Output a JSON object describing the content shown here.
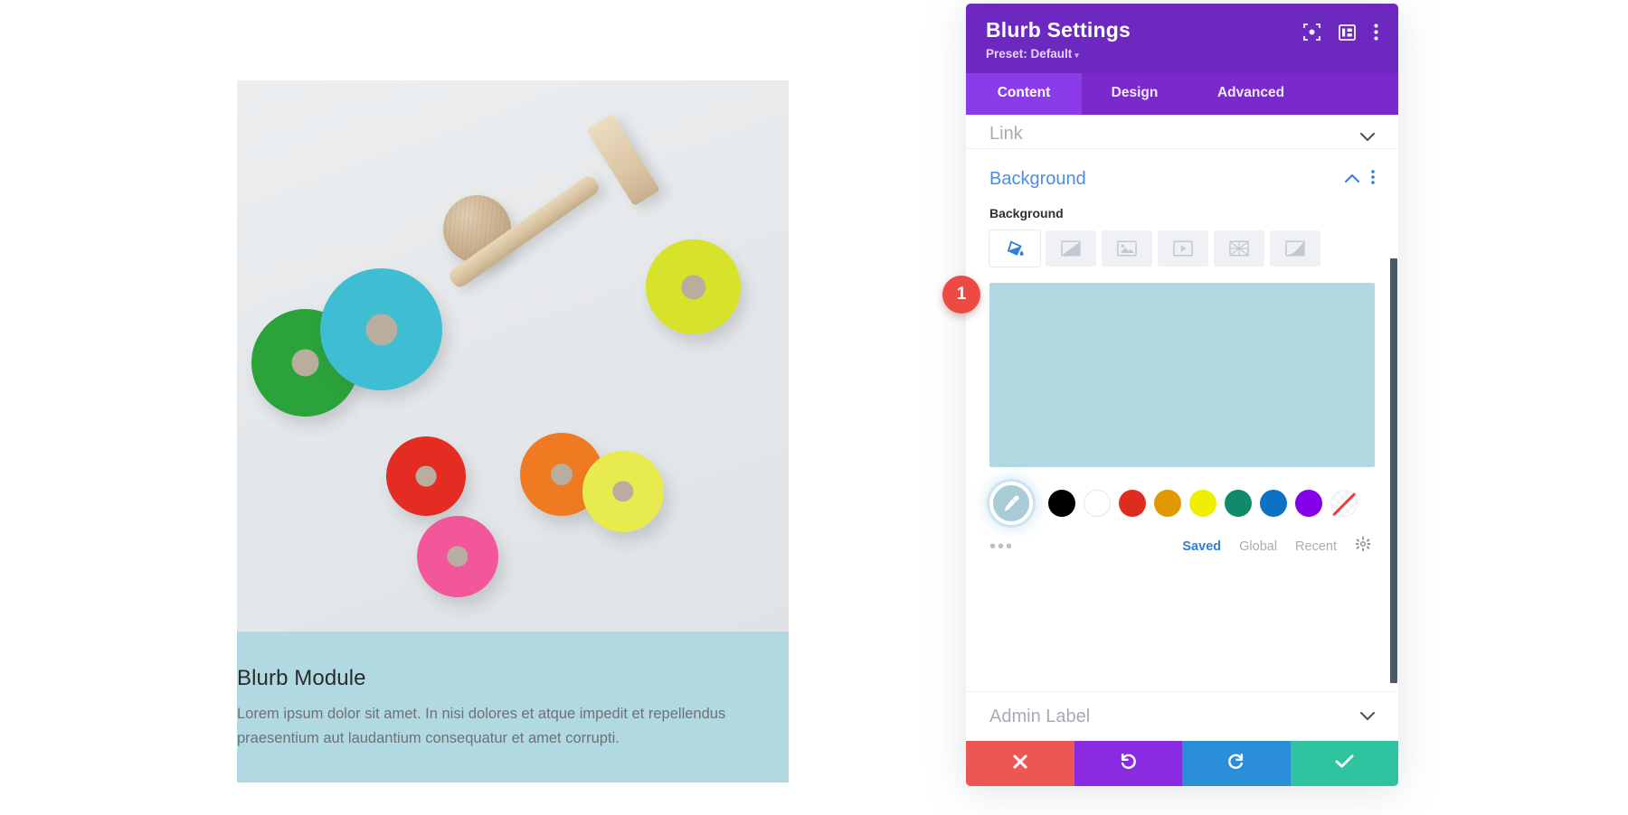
{
  "preview": {
    "blurb_title": "Blurb Module",
    "blurb_body": "Lorem ipsum dolor sit amet. In nisi dolores et atque impedit et repellendus praesentium aut laudantium consequatur et amet corrupti.",
    "blurb_bg_color": "#b1d9e2",
    "photo_alt": "wooden stacking toy rings with hammer and ball"
  },
  "panel": {
    "header": {
      "title": "Blurb Settings",
      "preset_label": "Preset: Default",
      "preset_caret": "▾",
      "bg_color": "#6d29bf",
      "icons": [
        {
          "name": "focus-target-icon",
          "title": "Focus"
        },
        {
          "name": "layout-columns-icon",
          "title": "Layout"
        },
        {
          "name": "vertical-dots-menu-icon",
          "title": "More"
        }
      ]
    },
    "tabs": [
      {
        "label": "Content",
        "active": true
      },
      {
        "label": "Design",
        "active": false
      },
      {
        "label": "Advanced",
        "active": false
      }
    ],
    "tabs_bg": "#7a29cc",
    "tabs_active_bg": "#8c3be8",
    "sections": {
      "link": {
        "label": "Link",
        "expanded": false
      },
      "background": {
        "label": "Background",
        "expanded": true,
        "accent_color": "#4c8ede",
        "field_label": "Background",
        "types": [
          {
            "name": "background-color-icon",
            "label": "Color",
            "active": true
          },
          {
            "name": "background-gradient-icon",
            "label": "Gradient",
            "active": false
          },
          {
            "name": "background-image-icon",
            "label": "Image",
            "active": false
          },
          {
            "name": "background-video-icon",
            "label": "Video",
            "active": false
          },
          {
            "name": "background-pattern-icon",
            "label": "Pattern",
            "active": false
          },
          {
            "name": "background-mask-icon",
            "label": "Mask",
            "active": false
          }
        ],
        "selected_color": "#b1d9e2",
        "swatches": [
          {
            "name": "swatch-black",
            "color": "#000000"
          },
          {
            "name": "swatch-white",
            "color": "#ffffff"
          },
          {
            "name": "swatch-red",
            "color": "#e02b20"
          },
          {
            "name": "swatch-orange",
            "color": "#e09900"
          },
          {
            "name": "swatch-yellow",
            "color": "#edf000"
          },
          {
            "name": "swatch-green",
            "color": "#118a6a"
          },
          {
            "name": "swatch-blue",
            "color": "#0c71c3"
          },
          {
            "name": "swatch-purple",
            "color": "#8300e9"
          },
          {
            "name": "swatch-transparent",
            "color": "none"
          }
        ],
        "eyedropper": {
          "name": "eyedropper-icon",
          "fill": "#a9ccd6"
        },
        "more_dots": "•••",
        "palette_tabs": [
          {
            "label": "Saved",
            "active": true
          },
          {
            "label": "Global",
            "active": false
          },
          {
            "label": "Recent",
            "active": false
          }
        ],
        "settings_icon": "gear-icon"
      },
      "admin_label": {
        "label": "Admin Label",
        "expanded": false
      }
    },
    "actions": [
      {
        "name": "cancel-button",
        "icon": "close-icon",
        "color": "#ee5653"
      },
      {
        "name": "undo-button",
        "icon": "undo-icon",
        "color": "#8a2be2"
      },
      {
        "name": "redo-button",
        "icon": "redo-icon",
        "color": "#2a8fd8"
      },
      {
        "name": "save-button",
        "icon": "check-icon",
        "color": "#2ec4a0"
      }
    ]
  },
  "annotation": {
    "badge_number": "1",
    "badge_color": "#ec4a42"
  }
}
